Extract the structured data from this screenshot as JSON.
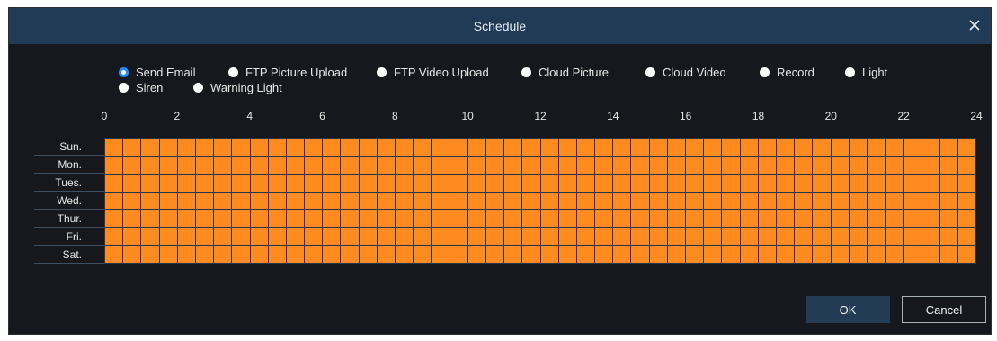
{
  "dialog": {
    "title": "Schedule",
    "close_icon": "close-icon"
  },
  "options": [
    {
      "label": "Send Email",
      "selected": true
    },
    {
      "label": "FTP Picture Upload",
      "selected": false
    },
    {
      "label": "FTP Video Upload",
      "selected": false
    },
    {
      "label": "Cloud Picture",
      "selected": false
    },
    {
      "label": "Cloud Video",
      "selected": false
    },
    {
      "label": "Record",
      "selected": false
    },
    {
      "label": "Light",
      "selected": false
    },
    {
      "label": "Siren",
      "selected": false
    },
    {
      "label": "Warning Light",
      "selected": false
    }
  ],
  "schedule": {
    "hour_labels": [
      "0",
      "2",
      "4",
      "6",
      "8",
      "10",
      "12",
      "14",
      "16",
      "18",
      "20",
      "22",
      "24"
    ],
    "days": [
      "Sun.",
      "Mon.",
      "Tues.",
      "Wed.",
      "Thur.",
      "Fri.",
      "Sat."
    ],
    "slots_per_day": 48,
    "all_slots_selected": true,
    "selected_color": "#ff8a1f",
    "grid_line_color": "#23374c"
  },
  "buttons": {
    "ok_label": "OK",
    "cancel_label": "Cancel"
  },
  "colors": {
    "dialog_bg": "#16181d",
    "titlebar_bg": "#213a55",
    "accent": "#1f8fff"
  }
}
